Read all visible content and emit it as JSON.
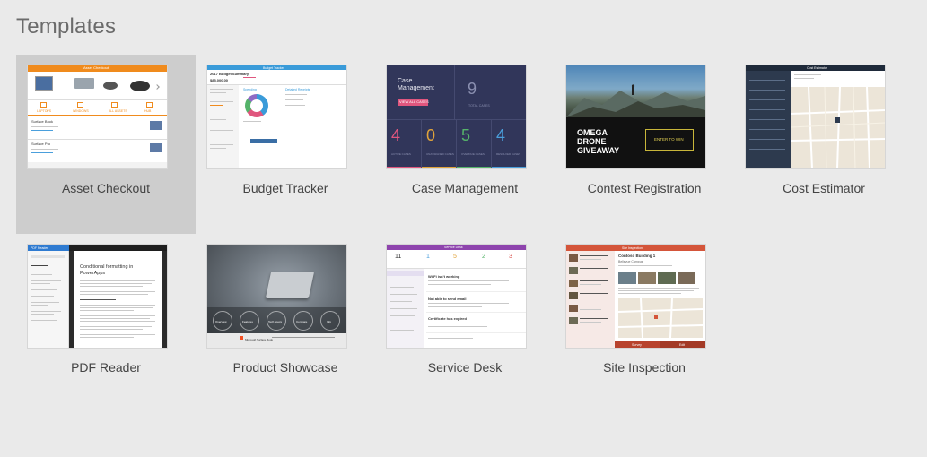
{
  "page": {
    "title": "Templates"
  },
  "templates": [
    {
      "label": "Asset Checkout",
      "selected": true,
      "preview": {
        "header": "Asset Checkout",
        "tabs": [
          "LAPTOPS",
          "WINDOWS",
          "ALL ASSETS",
          "HUB"
        ],
        "items": [
          "Surface Book",
          "Surface Pro"
        ]
      }
    },
    {
      "label": "Budget Tracker",
      "selected": false,
      "preview": {
        "header": "Budget Tracker",
        "title": "2017 Budget Summary",
        "amount": "$85,000.00",
        "section_a": "Spending",
        "section_b": "Detailed Receipts"
      }
    },
    {
      "label": "Case Management",
      "selected": false,
      "preview": {
        "title_line1": "Case",
        "title_line2": "Management",
        "button": "VIEW ALL CASES",
        "total_value": "9",
        "total_label": "TOTAL CASES",
        "stats": [
          {
            "value": "4",
            "label": "ACTIVE CASES",
            "color": "#e0567e"
          },
          {
            "value": "0",
            "label": "UNASSIGNED CASES",
            "color": "#e0a33a"
          },
          {
            "value": "5",
            "label": "OVERDUE CASES",
            "color": "#55b36a"
          },
          {
            "value": "4",
            "label": "RESOLVED CASES",
            "color": "#4a9fdc"
          }
        ]
      }
    },
    {
      "label": "Contest Registration",
      "selected": false,
      "preview": {
        "line1": "OMEGA",
        "line2": "DRONE",
        "line3": "GIVEAWAY",
        "button": "ENTER TO WIN"
      }
    },
    {
      "label": "Cost Estimator",
      "selected": false,
      "preview": {
        "header": "Cost Estimator"
      }
    },
    {
      "label": "PDF Reader",
      "selected": false,
      "preview": {
        "header": "PDF Reader",
        "doc_title_1": "Conditional formatting in",
        "doc_title_2": "PowerApps"
      }
    },
    {
      "label": "Product Showcase",
      "selected": false,
      "preview": {
        "circles": [
          "Overview",
          "Features",
          "Tech specs",
          "Compare",
          "Info"
        ],
        "brand": "Microsoft Surface Book"
      }
    },
    {
      "label": "Service Desk",
      "selected": false,
      "preview": {
        "header": "Service Desk",
        "counts": [
          {
            "value": "11",
            "color": "#333333"
          },
          {
            "value": "1",
            "color": "#4a9fdc"
          },
          {
            "value": "5",
            "color": "#e0a33a"
          },
          {
            "value": "2",
            "color": "#55b36a"
          },
          {
            "value": "3",
            "color": "#d9534f"
          }
        ],
        "tickets": [
          "Wi-Fi isn't working",
          "Not able to send email",
          "Certificate has expired"
        ]
      }
    },
    {
      "label": "Site Inspection",
      "selected": false,
      "preview": {
        "header": "Site Inspection",
        "site": "Contoso Building 1",
        "sub": "Bellevue Campus",
        "footer_left": "Survey",
        "footer_right": "Edit"
      }
    }
  ]
}
